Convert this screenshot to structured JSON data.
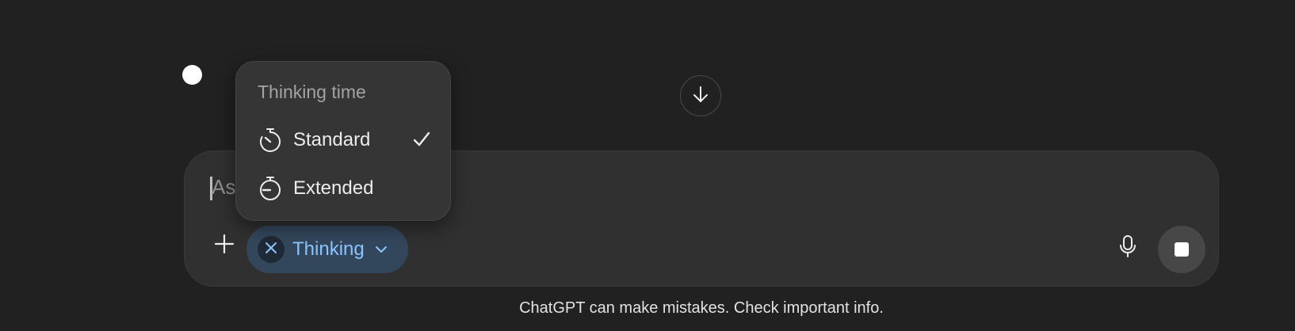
{
  "composer": {
    "placeholder": "As",
    "mode_pill": {
      "label": "Thinking",
      "active": true,
      "color": "#8cc4ff"
    }
  },
  "thinking_menu": {
    "title": "Thinking time",
    "items": [
      {
        "label": "Standard",
        "icon": "stopwatch-standard-icon",
        "selected": true
      },
      {
        "label": "Extended",
        "icon": "stopwatch-extended-icon",
        "selected": false
      }
    ]
  },
  "footer": {
    "disclaimer": "ChatGPT can make mistakes. Check important info."
  },
  "colors": {
    "background": "#212121",
    "composer_bg": "#303030",
    "menu_bg": "#353535",
    "pill_bg": "#33475c",
    "accent": "#8cc4ff"
  }
}
